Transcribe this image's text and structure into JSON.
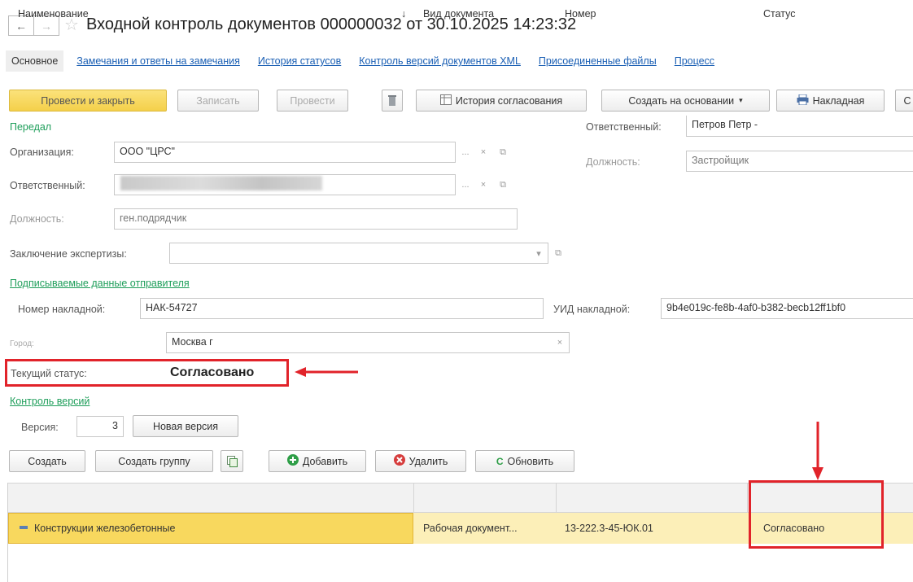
{
  "window": {
    "title": "Входной контроль документов 000000032 от 30.10.2025 14:23:32",
    "back_glyph": "←",
    "forward_glyph": "→",
    "star_glyph": "☆"
  },
  "tabs": [
    {
      "label": "Основное",
      "active": true
    },
    {
      "label": "Замечания и ответы на замечания"
    },
    {
      "label": "История статусов"
    },
    {
      "label": "Контроль версий документов XML"
    },
    {
      "label": "Присоединенные файлы"
    },
    {
      "label": "Процесс"
    }
  ],
  "toolbar": {
    "post_close": "Провести и закрыть",
    "write": "Записать",
    "post": "Провести",
    "approval_history": "История согласования",
    "create_based": "Создать на основании",
    "invoice": "Накладная",
    "more": "С"
  },
  "sender": {
    "section_label": "Передал",
    "org_label": "Организация:",
    "org_value": "ООО \"ЦРС\"",
    "resp_label": "Ответственный:",
    "position_label": "Должность:",
    "position_value": "ген.подрядчик",
    "expertise_label": "Заключение экспертизы:",
    "expertise_value": ""
  },
  "receiver": {
    "resp_label": "Ответственный:",
    "resp_value": "Петров Петр -",
    "position_label": "Должность:",
    "position_value": "Застройщик"
  },
  "signed": {
    "section_label": "Подписываемые данные отправителя",
    "invoice_no_label": "Номер накладной:",
    "invoice_no_value": "НАК-54727",
    "uid_label": "УИД накладной:",
    "uid_value": "9b4e019c-fe8b-4af0-b382-becb12ff1bf0",
    "city_label": "Город:",
    "city_value": "Москва г"
  },
  "status": {
    "label": "Текущий статус:",
    "value": "Согласовано"
  },
  "versions": {
    "section_label": "Контроль версий",
    "version_label": "Версия:",
    "version_value": "3",
    "new_version": "Новая версия"
  },
  "grid_toolbar": {
    "create": "Создать",
    "create_group": "Создать группу",
    "add": "Добавить",
    "delete": "Удалить",
    "refresh": "Обновить"
  },
  "grid": {
    "columns": [
      "Наименование",
      "Вид документа",
      "Номер",
      "Статус"
    ],
    "sort_glyph": "↓",
    "rows": [
      {
        "name": "Конструкции железобетонные",
        "doc_type": "Рабочая документ...",
        "number": "13-222.3-45-ЮК.01",
        "status": "Согласовано"
      }
    ]
  },
  "colors": {
    "accent_yellow": "#f4d04a",
    "link_blue": "#1a5fb4",
    "section_green": "#1e9e5a",
    "annotation_red": "#e1232a"
  }
}
